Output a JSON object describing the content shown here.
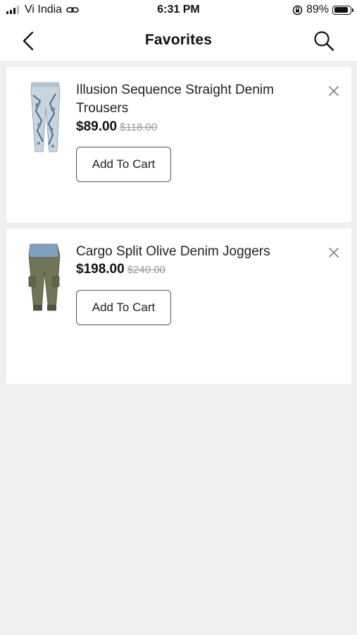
{
  "status_bar": {
    "carrier": "Vi India",
    "time": "6:31 PM",
    "battery_percent": "89%",
    "icons": [
      "signal-bars-icon",
      "link-icon",
      "orientation-lock-icon",
      "battery-icon"
    ]
  },
  "nav": {
    "title": "Favorites",
    "back_icon": "chevron-left-icon",
    "search_icon": "search-icon"
  },
  "favorites": [
    {
      "name": "Illusion Sequence Straight Denim Trousers",
      "price": "$89.00",
      "old_price": "$118.00",
      "button_label": "Add To Cart",
      "remove_icon": "close-icon"
    },
    {
      "name": "Cargo Split Olive Denim Joggers",
      "price": "$198.00",
      "old_price": "$240.00",
      "button_label": "Add To Cart",
      "remove_icon": "close-icon"
    }
  ],
  "colors": {
    "background": "#efefef",
    "card": "#ffffff",
    "text": "#111111",
    "muted": "#999999"
  }
}
